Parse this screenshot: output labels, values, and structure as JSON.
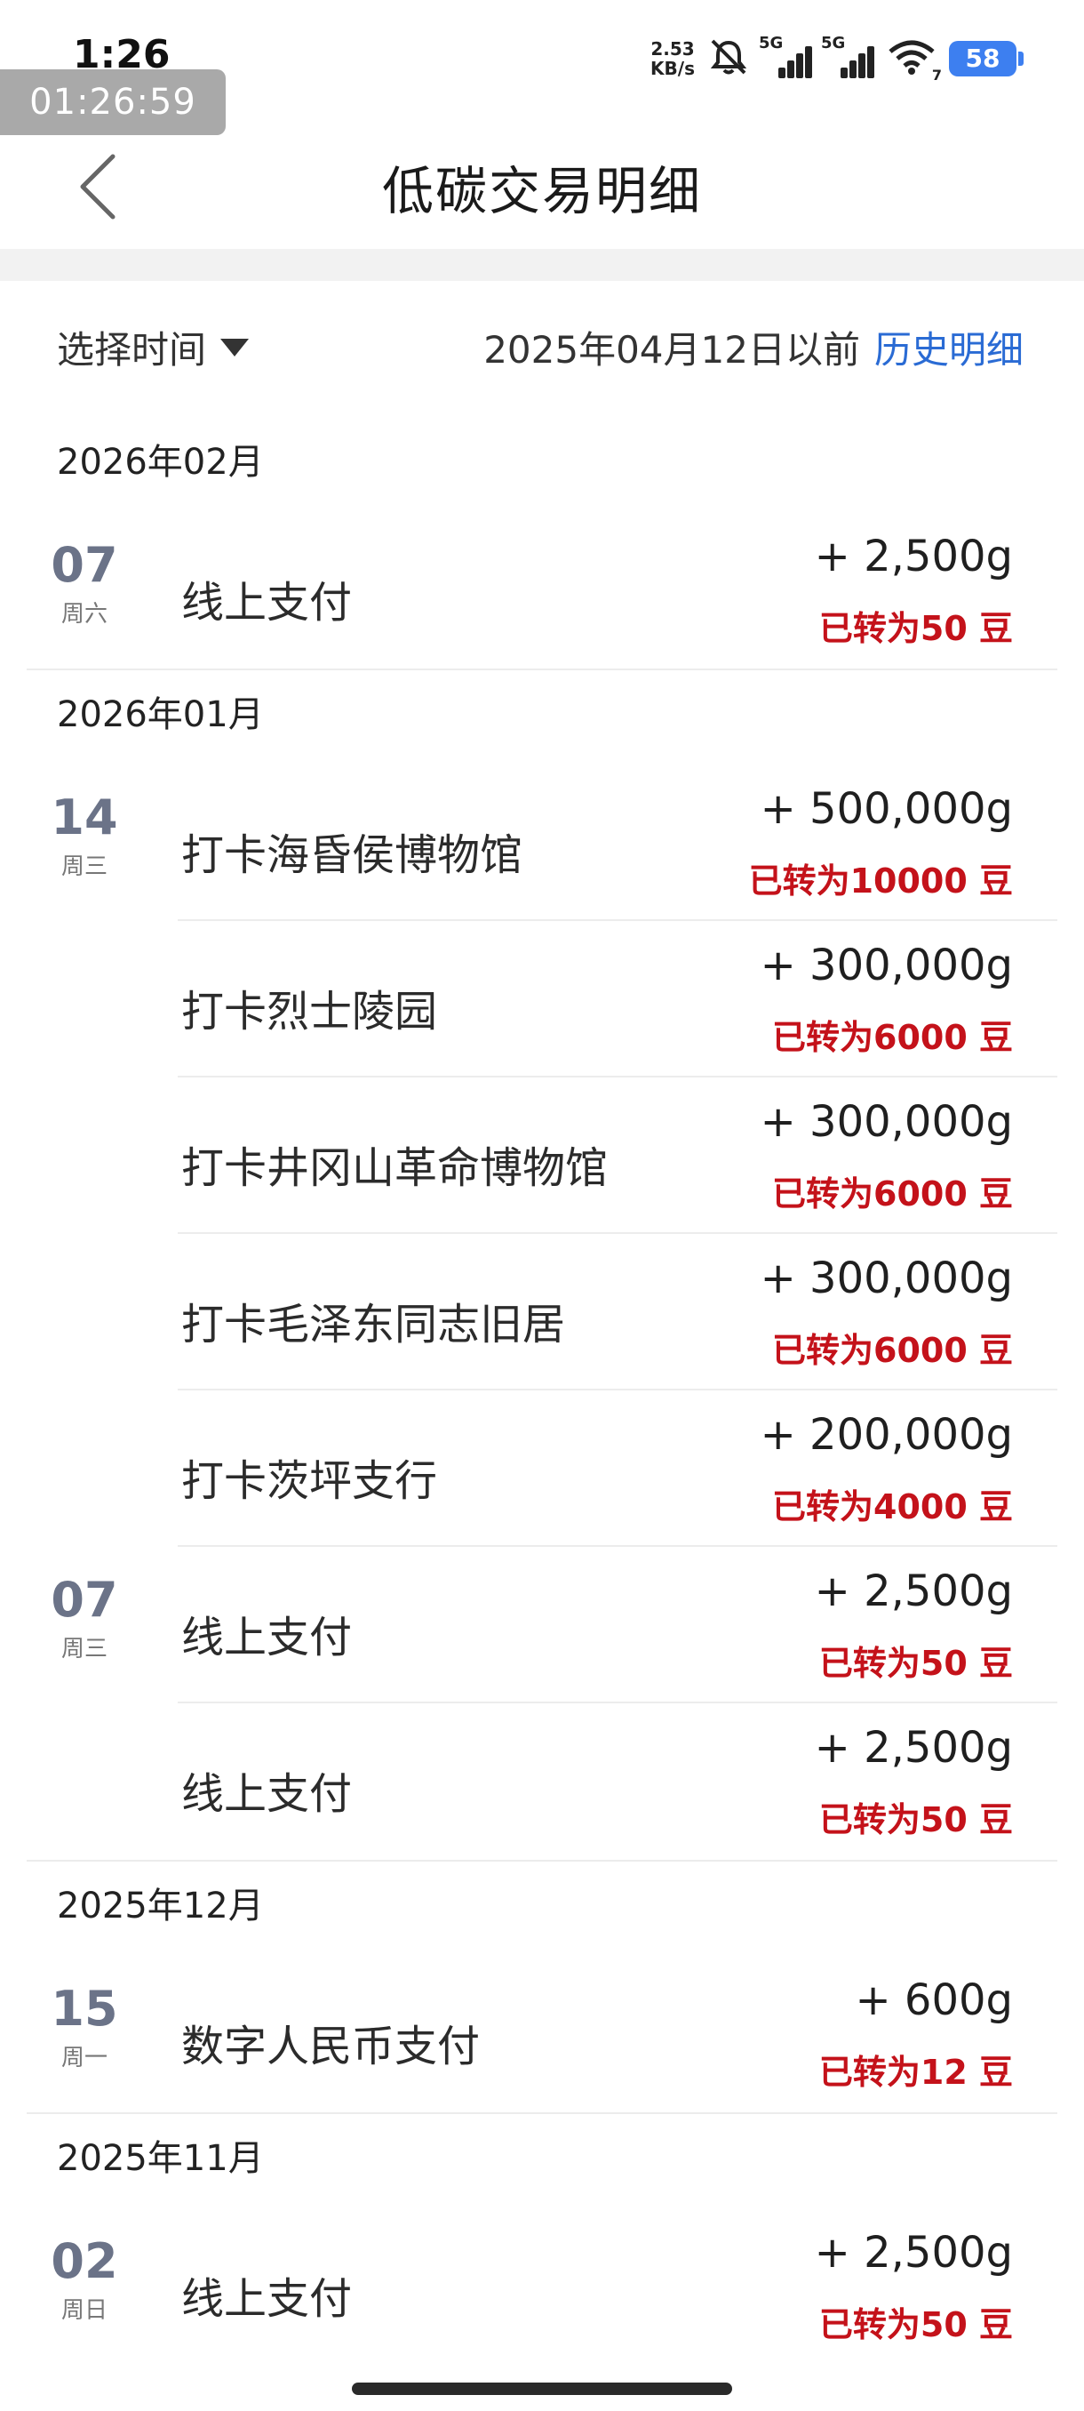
{
  "status_bar": {
    "time": "1:26",
    "timer": "01:26:59",
    "net_speed_value": "2.53",
    "net_speed_unit": "KB/s",
    "sim1": "5G",
    "sim2": "5G",
    "wifi_sub": "7",
    "battery": "58",
    "battery_color": "#3d7ff0"
  },
  "header": {
    "title": "低碳交易明细"
  },
  "filter": {
    "select_label": "选择时间",
    "before_text": "2025年04月12日以前",
    "history_link": "历史明细",
    "link_color": "#2a6bd4"
  },
  "accent_red": "#c4121a",
  "months": [
    {
      "label": "2026年02月",
      "days": [
        {
          "day": "07",
          "week": "周六",
          "items": [
            {
              "name": "线上支付",
              "amount": "+ 2,500g",
              "converted": "已转为50 豆"
            }
          ]
        }
      ]
    },
    {
      "label": "2026年01月",
      "days": [
        {
          "day": "14",
          "week": "周三",
          "items": [
            {
              "name": "打卡海昏侯博物馆",
              "amount": "+ 500,000g",
              "converted": "已转为10000 豆"
            },
            {
              "name": "打卡烈士陵园",
              "amount": "+ 300,000g",
              "converted": "已转为6000 豆"
            },
            {
              "name": "打卡井冈山革命博物馆",
              "amount": "+ 300,000g",
              "converted": "已转为6000 豆"
            },
            {
              "name": "打卡毛泽东同志旧居",
              "amount": "+ 300,000g",
              "converted": "已转为6000 豆"
            },
            {
              "name": "打卡茨坪支行",
              "amount": "+ 200,000g",
              "converted": "已转为4000 豆"
            }
          ]
        },
        {
          "day": "07",
          "week": "周三",
          "items": [
            {
              "name": "线上支付",
              "amount": "+ 2,500g",
              "converted": "已转为50 豆"
            },
            {
              "name": "线上支付",
              "amount": "+ 2,500g",
              "converted": "已转为50 豆"
            }
          ]
        }
      ]
    },
    {
      "label": "2025年12月",
      "days": [
        {
          "day": "15",
          "week": "周一",
          "items": [
            {
              "name": "数字人民币支付",
              "amount": "+ 600g",
              "converted": "已转为12 豆"
            }
          ]
        }
      ]
    },
    {
      "label": "2025年11月",
      "days": [
        {
          "day": "02",
          "week": "周日",
          "items": [
            {
              "name": "线上支付",
              "amount": "+ 2,500g",
              "converted": "已转为50 豆"
            }
          ]
        }
      ]
    }
  ]
}
